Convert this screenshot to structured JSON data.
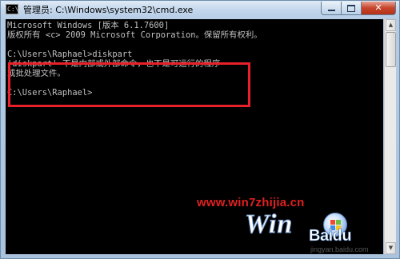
{
  "window": {
    "title": "管理员: C:\\Windows\\system32\\cmd.exe",
    "icon": "cmd-icon",
    "icon_glyph": "C:\\",
    "buttons": {
      "minimize": "minimize-icon",
      "maximize": "maximize-icon",
      "close": "close-icon",
      "close_glyph": "✕"
    }
  },
  "console": {
    "lines": [
      "Microsoft Windows [版本 6.1.7600]",
      "版权所有 <c> 2009 Microsoft Corporation。保留所有权利。",
      "",
      "C:\\Users\\Raphael>diskpart",
      "'diskpart' 不是内部或外部命令，也不是可运行的程序",
      "或批处理文件。",
      "",
      "C:\\Users\\Raphael>"
    ],
    "text_color": "#c0c0c0",
    "background": "#000000"
  },
  "scrollbar": {
    "up": "▲",
    "down": "▼"
  },
  "annotation": {
    "color": "#e8202a"
  },
  "watermark": {
    "url": "www.win7zhijia.cn",
    "logo_text": "Win",
    "logo_suffix": "Bai",
    "logo_brand": "du",
    "sub": "jingyan.baidu.com"
  }
}
